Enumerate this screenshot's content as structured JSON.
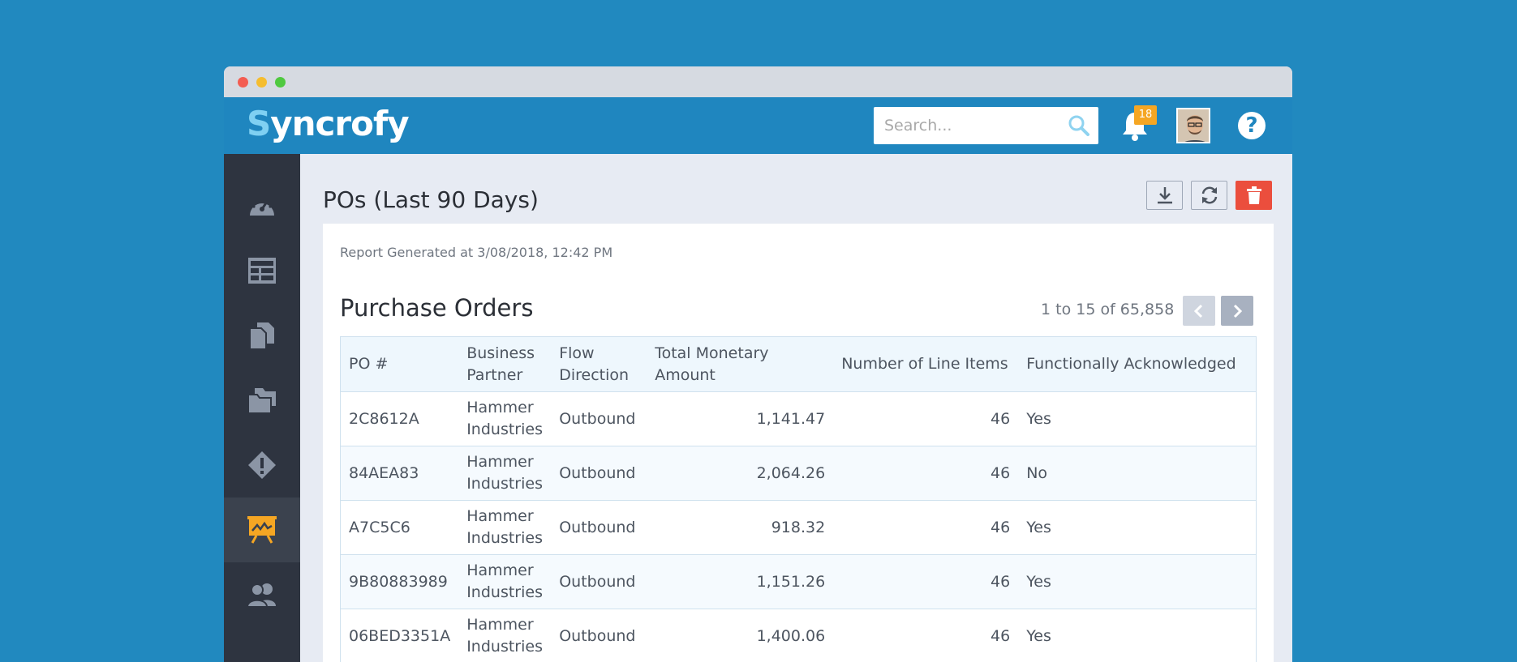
{
  "header": {
    "logo_s": "S",
    "logo_rest": "yncrofy",
    "search_placeholder": "Search...",
    "notification_count": "18",
    "help_label": "?"
  },
  "page": {
    "title": "POs (Last 90 Days)",
    "generated": "Report Generated at 3/08/2018, 12:42 PM",
    "section_title": "Purchase Orders",
    "pager_text": "1 to 15 of 65,858"
  },
  "table": {
    "headers": [
      "PO #",
      "Business Partner",
      "Flow Direction",
      "Total Monetary Amount",
      "Number of Line Items",
      "Functionally Acknowledged"
    ],
    "rows": [
      [
        "2C8612A",
        "Hammer Industries",
        "Outbound",
        "1,141.47",
        "46",
        "Yes"
      ],
      [
        "84AEA83",
        "Hammer Industries",
        "Outbound",
        "2,064.26",
        "46",
        "No"
      ],
      [
        "A7C5C6",
        "Hammer Industries",
        "Outbound",
        "918.32",
        "46",
        "Yes"
      ],
      [
        "9B80883989",
        "Hammer Industries",
        "Outbound",
        "1,151.26",
        "46",
        "Yes"
      ],
      [
        "06BED3351A",
        "Hammer Industries",
        "Outbound",
        "1,400.06",
        "46",
        "Yes"
      ]
    ]
  },
  "colors": {
    "background": "#2189bf",
    "appbar": "#1f86bf",
    "sidebar": "#2e3440",
    "active_icon": "#f5a623",
    "danger": "#eb4e3d"
  },
  "sidebar_icons": [
    "dashboard-gauge-icon",
    "layout-list-icon",
    "documents-icon",
    "folders-icon",
    "alert-diamond-icon",
    "report-chart-icon",
    "users-icon"
  ]
}
